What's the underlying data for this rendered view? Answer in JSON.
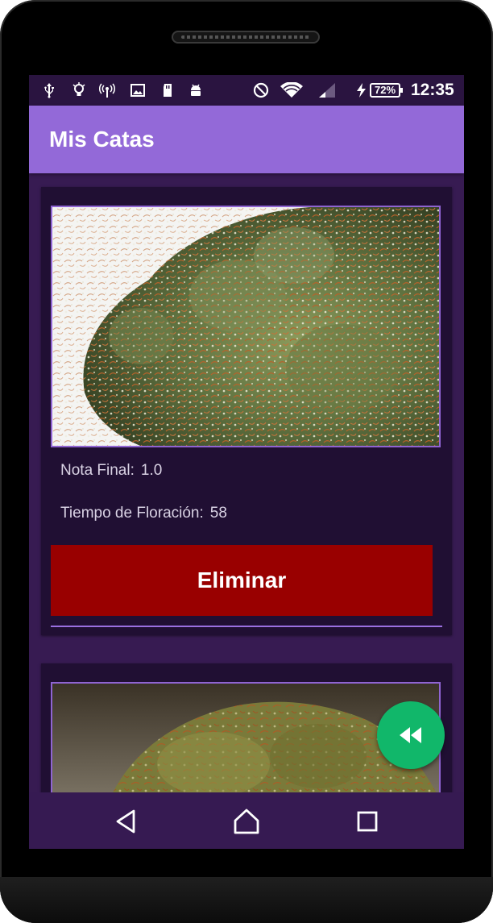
{
  "status_bar": {
    "battery_percent": "72%",
    "time": "12:35",
    "icons": [
      "usb-icon",
      "lightbulb-icon",
      "hotspot-icon",
      "image-icon",
      "sd-card-icon",
      "android-icon",
      "do-not-disturb-icon",
      "wifi-icon",
      "cell-signal-icon",
      "charging-icon",
      "battery-icon"
    ]
  },
  "app_bar": {
    "title": "Mis Catas"
  },
  "cards": [
    {
      "image": "cannabis-bud-photo",
      "nota_label": "Nota Final:",
      "nota_value": "1.0",
      "tiempo_label": "Tiempo de Floración:",
      "tiempo_value": "58",
      "delete_label": "Eliminar"
    },
    {
      "image": "cannabis-bud-photo"
    }
  ],
  "fab": {
    "icon": "fast-rewind-icon",
    "color": "#11b76a"
  },
  "nav_bar": {
    "icons": [
      "back-icon",
      "home-icon",
      "recents-icon"
    ]
  },
  "colors": {
    "app_bar": "#9369d8",
    "background": "#371b52",
    "card": "#200f33",
    "delete_button": "#990000"
  }
}
